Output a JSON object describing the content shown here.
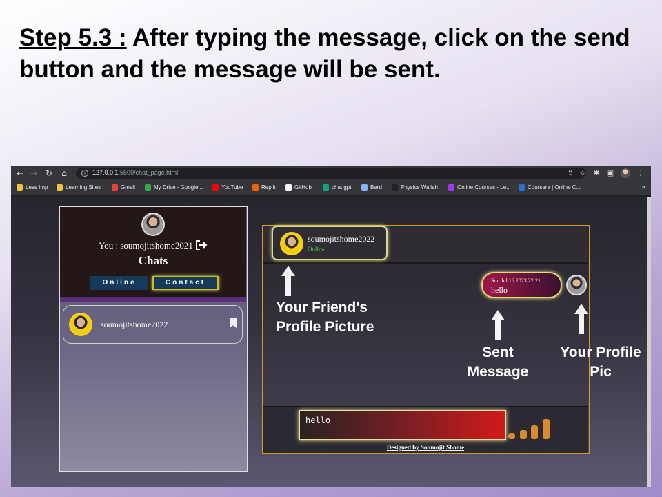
{
  "slide": {
    "step_label": "Step 5.3 :",
    "title_rest": " After typing the message, click on the send button and the message will be sent."
  },
  "browser": {
    "url_host": "127.0.0.1",
    "url_path": ":5500/chat_page.html",
    "bookmarks": [
      {
        "label": "Less Imp",
        "color": "#f0c040"
      },
      {
        "label": "Learning Sites",
        "color": "#f0c040"
      },
      {
        "label": "Gmail",
        "color": "#ea4335"
      },
      {
        "label": "My Drive - Google...",
        "color": "#34a853"
      },
      {
        "label": "YouTube",
        "color": "#ff0000"
      },
      {
        "label": "Replit",
        "color": "#f26207"
      },
      {
        "label": "GitHub",
        "color": "#ffffff"
      },
      {
        "label": "chat gpt",
        "color": "#10a37f"
      },
      {
        "label": "Bard",
        "color": "#8ab4f8"
      },
      {
        "label": "Physics Wallah",
        "color": "#222222"
      },
      {
        "label": "Online Courses - Le...",
        "color": "#a435f0"
      },
      {
        "label": "Coursera | Online C...",
        "color": "#2a73cc"
      }
    ]
  },
  "sidebar": {
    "you_label": "You : soumojitshome2021",
    "chats_title": "Chats",
    "tab_online": "Online",
    "tab_contact": "Contact",
    "contact_name": "soumojitshome2022"
  },
  "chat": {
    "friend_name": "soumojitshome2022",
    "friend_status": "Online",
    "message_time": "Sun Jul 16 2023 22:21",
    "message_text": "hello",
    "input_value": "hello",
    "footer_credit": "Designed by Soumojit Shome"
  },
  "annotations": {
    "friend_pic": "Your Friend's\nProfile Picture",
    "sent_message": "Sent\nMessage",
    "your_pic": "Your Profile\nPic"
  }
}
